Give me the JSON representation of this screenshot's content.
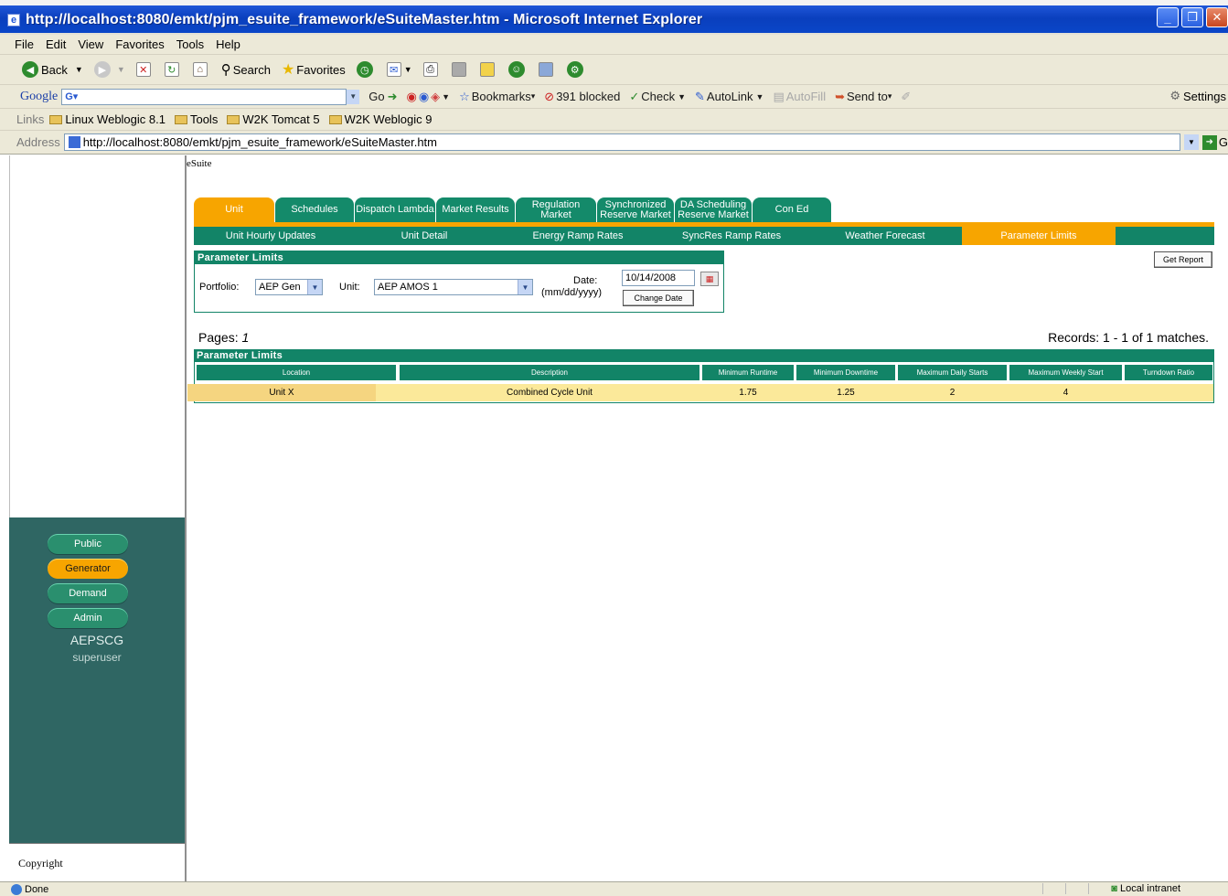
{
  "browser": {
    "title": "http://localhost:8080/emkt/pjm_esuite_framework/eSuiteMaster.htm - Microsoft Internet Explorer",
    "menu": [
      "File",
      "Edit",
      "View",
      "Favorites",
      "Tools",
      "Help"
    ],
    "toolbar": {
      "back": "Back",
      "search": "Search",
      "favorites": "Favorites"
    },
    "google": {
      "logo": "Google",
      "go": "Go",
      "bookmarks": "Bookmarks",
      "blocked": "391 blocked",
      "check": "Check",
      "autolink": "AutoLink",
      "autofill": "AutoFill",
      "sendto": "Send to",
      "settings": "Settings"
    },
    "links": {
      "label": "Links",
      "items": [
        "Linux Weblogic 8.1",
        "Tools",
        "W2K Tomcat 5",
        "W2K Weblogic 9"
      ]
    },
    "address": {
      "label": "Address",
      "url": "http://localhost:8080/emkt/pjm_esuite_framework/eSuiteMaster.htm",
      "go": "G"
    },
    "status": {
      "left": "Done",
      "zone": "Local intranet"
    }
  },
  "page": {
    "frame_title": "eSuite",
    "tabs": [
      "Unit",
      "Schedules",
      "Dispatch Lambda",
      "Market Results",
      "Regulation Market",
      "Synchronized Reserve Market",
      "DA Scheduling Reserve Market",
      "Con Ed"
    ],
    "subtabs": [
      "Unit Hourly Updates",
      "Unit Detail",
      "Energy Ramp Rates",
      "SyncRes Ramp Rates",
      "Weather Forecast",
      "Parameter Limits"
    ],
    "filter": {
      "title": "Parameter Limits",
      "portfolio_label": "Portfolio:",
      "portfolio_value": "AEP Gen",
      "unit_label": "Unit:",
      "unit_value": "AEP AMOS 1",
      "date_label": "Date:",
      "date_format": "(mm/dd/yyyy)",
      "date_value": "10/14/2008",
      "change_date": "Change Date"
    },
    "get_report": "Get Report",
    "pages_label": "Pages:",
    "pages_value": "1",
    "records": "Records: 1 - 1 of 1 matches.",
    "grid": {
      "title": "Parameter Limits",
      "columns": [
        "Location",
        "Description",
        "Minimum Runtime",
        "Minimum Downtime",
        "Maximum Daily Starts",
        "Maximum Weekly Start",
        "Turndown Ratio"
      ],
      "rows": [
        [
          "Unit X",
          "Combined Cycle Unit",
          "1.75",
          "1.25",
          "2",
          "4",
          ""
        ]
      ]
    }
  },
  "nav": {
    "buttons": [
      "Public",
      "Generator",
      "Demand",
      "Admin"
    ],
    "active": "Generator",
    "org": "AEPSCG",
    "user": "superuser",
    "copyright": "Copyright"
  }
}
